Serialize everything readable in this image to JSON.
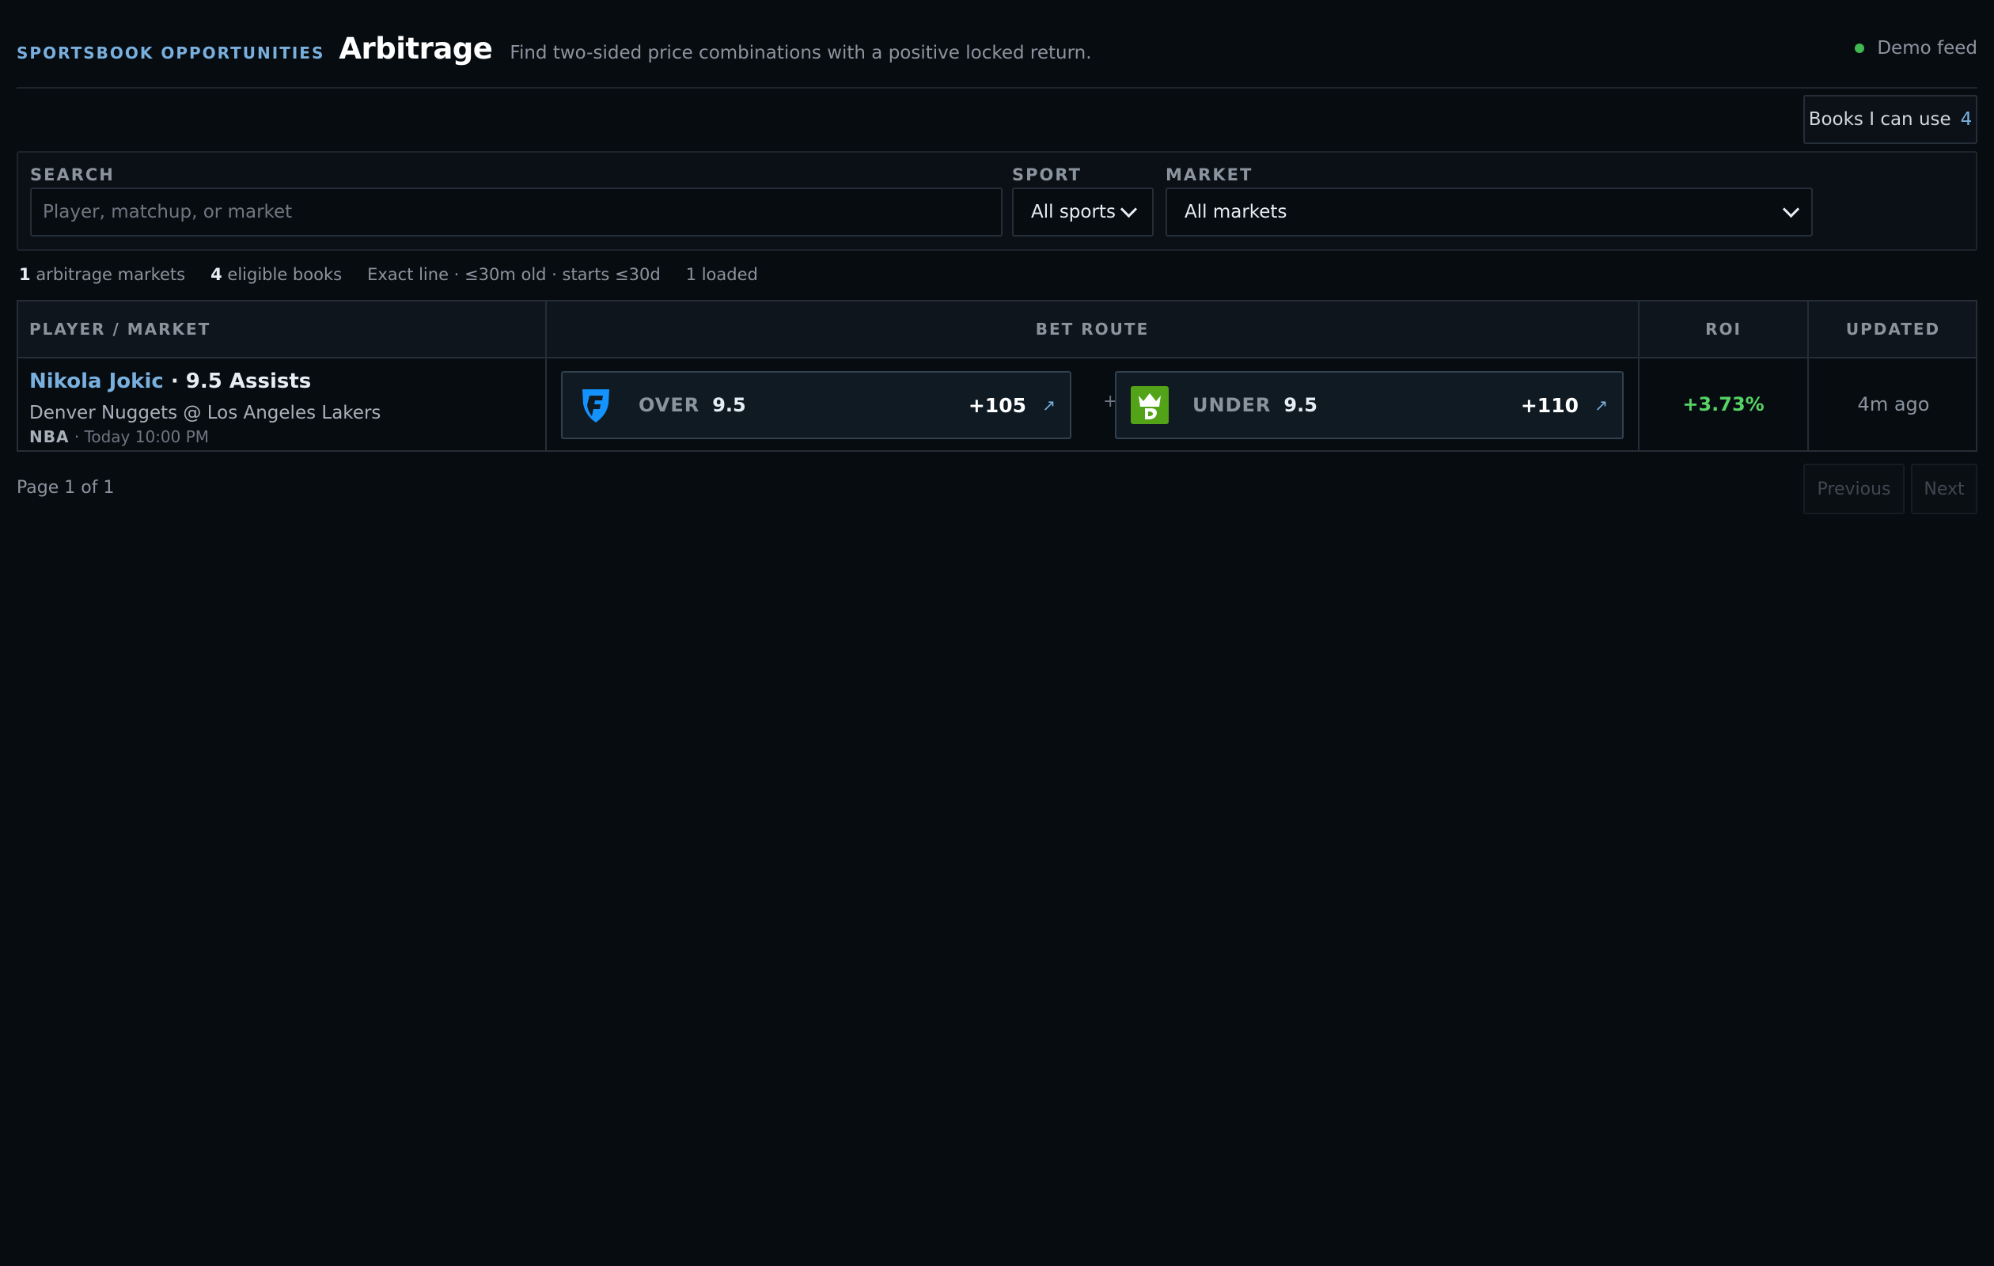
{
  "header": {
    "eyebrow": "SPORTSBOOK OPPORTUNITIES",
    "title": "Arbitrage",
    "subtitle": "Find two-sided price combinations with a positive locked return.",
    "feed_label": "Demo feed",
    "feed_status_color": "#3fb950"
  },
  "books_button": {
    "label": "Books I can use",
    "count": "4"
  },
  "filters": {
    "search": {
      "label": "SEARCH",
      "placeholder": "Player, matchup, or market",
      "value": ""
    },
    "sport": {
      "label": "SPORT",
      "value": "All sports"
    },
    "market": {
      "label": "MARKET",
      "value": "All markets"
    }
  },
  "stats": {
    "arb_count": "1",
    "arb_label": "arbitrage markets",
    "books_count": "4",
    "books_label": "eligible books",
    "rules": "Exact line · ≤30m old · starts ≤30d",
    "loaded": "1 loaded"
  },
  "table": {
    "columns": [
      "PLAYER / MARKET",
      "BET ROUTE",
      "ROI",
      "UPDATED"
    ],
    "rows": [
      {
        "player": "Nikola Jokic",
        "market": " · 9.5 Assists",
        "matchup": "Denver Nuggets @ Los Angeles Lakers",
        "league": "NBA",
        "sep": " · ",
        "start": "Today 10:00 PM",
        "legs": [
          {
            "book_icon": "fanduel-logo-icon",
            "side": "OVER",
            "line": "9.5",
            "odds": "+105",
            "link_icon": "external-link-icon"
          },
          {
            "book_icon": "draftkings-logo-icon",
            "side": "UNDER",
            "line": "9.5",
            "odds": "+110",
            "link_icon": "external-link-icon"
          }
        ],
        "joiner": "+",
        "roi": "+3.73%",
        "updated": "4m ago"
      }
    ]
  },
  "pagination": {
    "info": "Page 1 of 1",
    "prev": "Previous",
    "next": "Next"
  },
  "colors": {
    "accent": "#79b0de",
    "positive": "#56d364",
    "background": "#070c11",
    "fanduel": "#1493ff",
    "draftkings": "#53a318"
  }
}
